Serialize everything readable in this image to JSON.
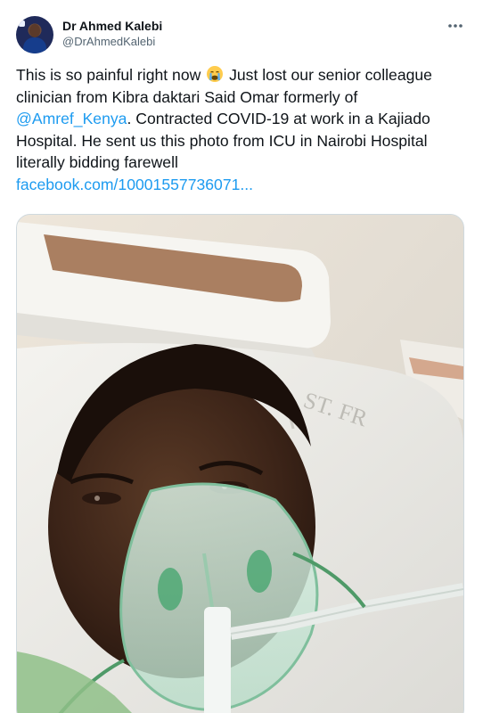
{
  "author": {
    "display_name": "Dr Ahmed Kalebi",
    "handle": "@DrAhmedKalebi"
  },
  "tweet": {
    "text_part1": "This is so painful right now ",
    "emoji": "crying-face",
    "text_part2": " Just lost our senior colleague clinician from Kibra daktari Said Omar formerly of ",
    "mention": "@Amref_Kenya",
    "text_part3": ". Contracted COVID-19 at work in a Kajiado Hospital. He sent us this photo from ICU in Nairobi Hospital literally bidding farewell",
    "link": "facebook.com/10001557736071..."
  },
  "media": {
    "type": "photo",
    "subject": "patient-in-hospital-bed-with-oxygen-mask"
  },
  "icons": {
    "more": "more-horizontal-icon"
  },
  "colors": {
    "link": "#1d9bf0",
    "text": "#0f1419",
    "secondary_text": "#536471",
    "border": "#cfd9de"
  }
}
